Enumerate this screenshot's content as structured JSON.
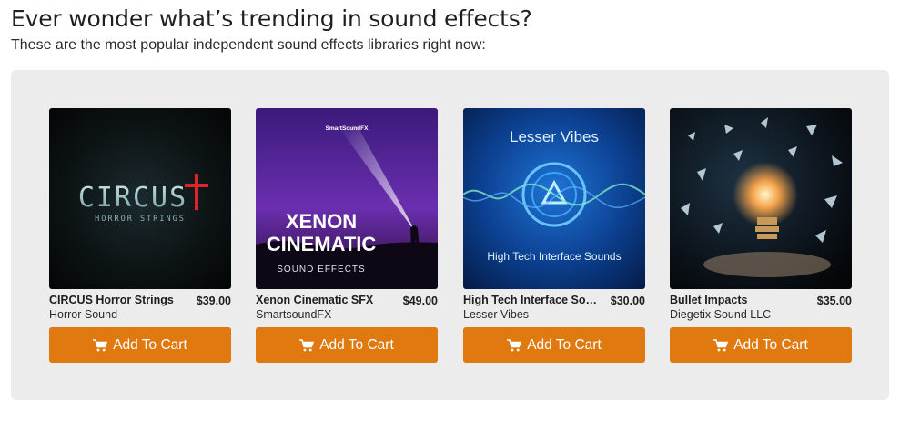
{
  "header": {
    "title": "Ever wonder what’s trending in sound effects?",
    "subtitle": "These are the most popular independent sound effects libraries right now:"
  },
  "products": [
    {
      "title": "CIRCUS Horror Strings",
      "artist": "Horror Sound",
      "price": "$39.00",
      "button": "Add To Cart",
      "cover": {
        "line1": "CIRCUS",
        "line2": "HORROR STRINGS",
        "icon": "cross-icon"
      }
    },
    {
      "title": "Xenon Cinematic SFX",
      "artist": "SmartsoundFX",
      "price": "$49.00",
      "button": "Add To Cart",
      "cover": {
        "brand": "SmartSoundFX",
        "line1": "XENON",
        "line2": "CINEMATIC",
        "line3": "SOUND EFFECTS"
      }
    },
    {
      "title": "High Tech Interface Sounds",
      "artist": "Lesser Vibes",
      "price": "$30.00",
      "button": "Add To Cart",
      "cover": {
        "line1": "Lesser Vibes",
        "line2": "High Tech Interface Sounds"
      }
    },
    {
      "title": "Bullet Impacts",
      "artist": "Diegetix Sound LLC",
      "price": "$35.00",
      "button": "Add To Cart",
      "cover": {
        "icon": "shattering-bulb-image"
      }
    }
  ],
  "colors": {
    "accent": "#e07a10",
    "panel": "#ececec"
  }
}
